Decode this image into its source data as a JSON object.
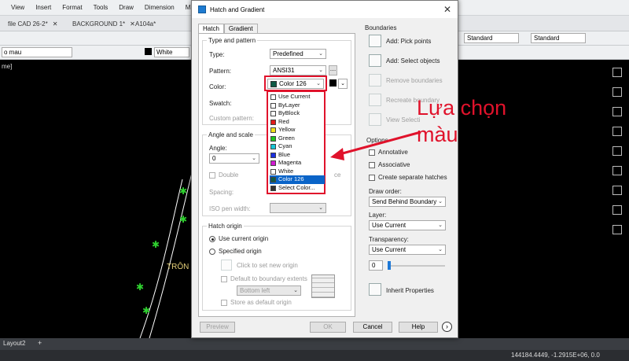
{
  "acad": {
    "menu": [
      "View",
      "Insert",
      "Format",
      "Tools",
      "Draw",
      "Dimension",
      "M"
    ],
    "tabs": [
      "file CAD 26-2*",
      "BACKGROUND 1*",
      "A104a*"
    ],
    "layer_text": "o mau",
    "color_text": "White",
    "right_style_1": "Standard",
    "right_style_2": "Standard",
    "viewport_label": "me]",
    "drawing_text": "TRÔN",
    "layout_tab": "Layout2",
    "add_tab": "+",
    "coords": "144184.4449, -1.2915E+06, 0.0"
  },
  "dialog": {
    "title": "Hatch and Gradient",
    "close": "✕",
    "tabs": {
      "hatch": "Hatch",
      "gradient": "Gradient"
    },
    "type_pattern": {
      "group": "Type and pattern",
      "type_label": "Type:",
      "type_value": "Predefined",
      "pattern_label": "Pattern:",
      "pattern_value": "ANSI31",
      "color_label": "Color:",
      "color_value": "Color 126",
      "swatch_label": "Swatch:",
      "custom_label": "Custom pattern:"
    },
    "angle_scale": {
      "group": "Angle and scale",
      "angle_label": "Angle:",
      "angle_value": "0",
      "double_label": "Double",
      "relative_tail": "ce",
      "spacing_label": "Spacing:",
      "iso_label": "ISO pen width:"
    },
    "hatch_origin": {
      "group": "Hatch origin",
      "use_current": "Use current origin",
      "specified": "Specified origin",
      "click_set": "Click to set new origin",
      "default_extents": "Default to boundary extents",
      "position_value": "Bottom left",
      "store_default": "Store as default origin"
    },
    "boundaries": {
      "group": "Boundaries",
      "add_pick": "Add: Pick points",
      "add_select": "Add: Select objects",
      "remove": "Remove boundaries",
      "recreate": "Recreate boundary",
      "view_select": "View Selecti"
    },
    "options": {
      "group": "Options",
      "annotative": "Annotative",
      "associative": "Associative",
      "separate": "Create separate hatches",
      "draw_order_label": "Draw order:",
      "draw_order_value": "Send Behind Boundary",
      "layer_label": "Layer:",
      "layer_value": "Use Current",
      "transparency_label": "Transparency:",
      "transparency_value": "Use Current",
      "transparency_number": "0"
    },
    "inherit": "Inherit Properties",
    "buttons": {
      "preview": "Preview",
      "ok": "OK",
      "cancel": "Cancel",
      "help": "Help",
      "more": "›"
    }
  },
  "color_dropdown": {
    "items": [
      {
        "label": "Use Current",
        "color": "#ffffff"
      },
      {
        "label": "ByLayer",
        "color": "#ffffff"
      },
      {
        "label": "ByBlock",
        "color": "#ffffff"
      },
      {
        "label": "Red",
        "color": "#e21b1b"
      },
      {
        "label": "Yellow",
        "color": "#f2e21a"
      },
      {
        "label": "Green",
        "color": "#1ec41e"
      },
      {
        "label": "Cyan",
        "color": "#17c6d6"
      },
      {
        "label": "Blue",
        "color": "#1a2fe0"
      },
      {
        "label": "Magenta",
        "color": "#d11ad1"
      },
      {
        "label": "White",
        "color": "#ffffff"
      },
      {
        "label": "Color 126",
        "color": "#0f5a46"
      },
      {
        "label": "Select Color...",
        "color": "#333333"
      }
    ],
    "selected_index": 10
  },
  "annotation": {
    "line1": "Lựa chọn",
    "line2": "màu"
  },
  "colors": {
    "accent_red": "#e0122b",
    "selected_blue": "#0a64c8",
    "color_126": "#0f5a46"
  }
}
